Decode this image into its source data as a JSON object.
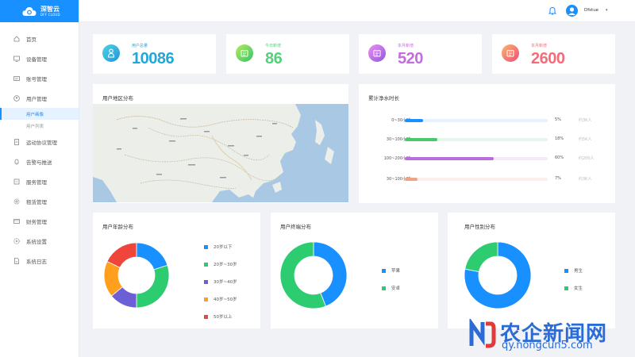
{
  "brand": {
    "name": "深智云",
    "sub": "DFF CLOUD",
    "color": "#1890ff"
  },
  "sidebar": {
    "items": [
      {
        "label": "首页",
        "icon": "home-icon"
      },
      {
        "label": "设备管理",
        "icon": "monitor-icon"
      },
      {
        "label": "账号管理",
        "icon": "id-card-icon"
      },
      {
        "label": "用户管理",
        "icon": "user-icon"
      },
      {
        "label": "运动协议管理",
        "icon": "document-icon"
      },
      {
        "label": "告警与推送",
        "icon": "bell-outline-icon"
      },
      {
        "label": "服务管理",
        "icon": "service-icon"
      },
      {
        "label": "租赁管理",
        "icon": "gear-icon"
      },
      {
        "label": "财务管理",
        "icon": "wallet-icon"
      },
      {
        "label": "系统设置",
        "icon": "settings-icon"
      },
      {
        "label": "系统日志",
        "icon": "log-icon"
      }
    ],
    "subitems": [
      {
        "label": "用户画像",
        "active": true
      },
      {
        "label": "用户列表",
        "active": false
      }
    ]
  },
  "header": {
    "username": "Dfstue",
    "caret": "▾"
  },
  "stats": [
    {
      "label": "用户总量",
      "value": "10086",
      "color": "#20a8d8",
      "icon": "user-count-icon"
    },
    {
      "label": "今日新增",
      "value": "86",
      "color": "#4ed37a",
      "icon": "calendar-icon"
    },
    {
      "label": "本月新增",
      "value": "520",
      "color": "#c46cdf",
      "icon": "calendar-month-icon"
    },
    {
      "label": "本月新增",
      "value": "2600",
      "color": "#f36c7a",
      "icon": "calendar-stack-icon"
    }
  ],
  "map_card": {
    "title": "用户地区分布"
  },
  "duration_card": {
    "title": "累计净水时长",
    "rows": [
      {
        "label": "0~30小时",
        "pct": "5%",
        "value": 0.13,
        "count": "约3K人",
        "color": "#1890ff",
        "track": "#e8f2fd"
      },
      {
        "label": "30~100小时",
        "pct": "18%",
        "value": 0.23,
        "count": "约5K人",
        "color": "#45c96b",
        "track": "#e7f6eb"
      },
      {
        "label": "100~200小时",
        "pct": "60%",
        "value": 0.62,
        "count": "约200人",
        "color": "#b96ddb",
        "track": "#f3ebf9"
      },
      {
        "label": "30~100小时",
        "pct": "7%",
        "value": 0.09,
        "count": "约3K人",
        "color": "#f0a487",
        "track": "#fcefea"
      }
    ]
  },
  "age_card": {
    "title": "用户年龄分布",
    "legend": [
      {
        "label": "20岁以下",
        "color": "#1890ff",
        "value": 20
      },
      {
        "label": "20岁~30岁",
        "color": "#2ecc71",
        "value": 30
      },
      {
        "label": "30岁~40岁",
        "color": "#6c5fd6",
        "value": 14
      },
      {
        "label": "40岁~50岁",
        "color": "#ff9f1c",
        "value": 18
      },
      {
        "label": "50岁以上",
        "color": "#f0453a",
        "value": 18
      }
    ]
  },
  "device_card": {
    "title": "用户终端分布",
    "legend": [
      {
        "label": "苹果",
        "color": "#1890ff",
        "value": 44
      },
      {
        "label": "安卓",
        "color": "#2ecc71",
        "value": 56
      }
    ]
  },
  "gender_card": {
    "title": "用户性别分布",
    "legend": [
      {
        "label": "男生",
        "color": "#1890ff",
        "value": 78
      },
      {
        "label": "女生",
        "color": "#2ecc71",
        "value": 22
      }
    ]
  },
  "watermark": {
    "title": "农企新闻网",
    "url": "qy.nongcun5.com"
  }
}
